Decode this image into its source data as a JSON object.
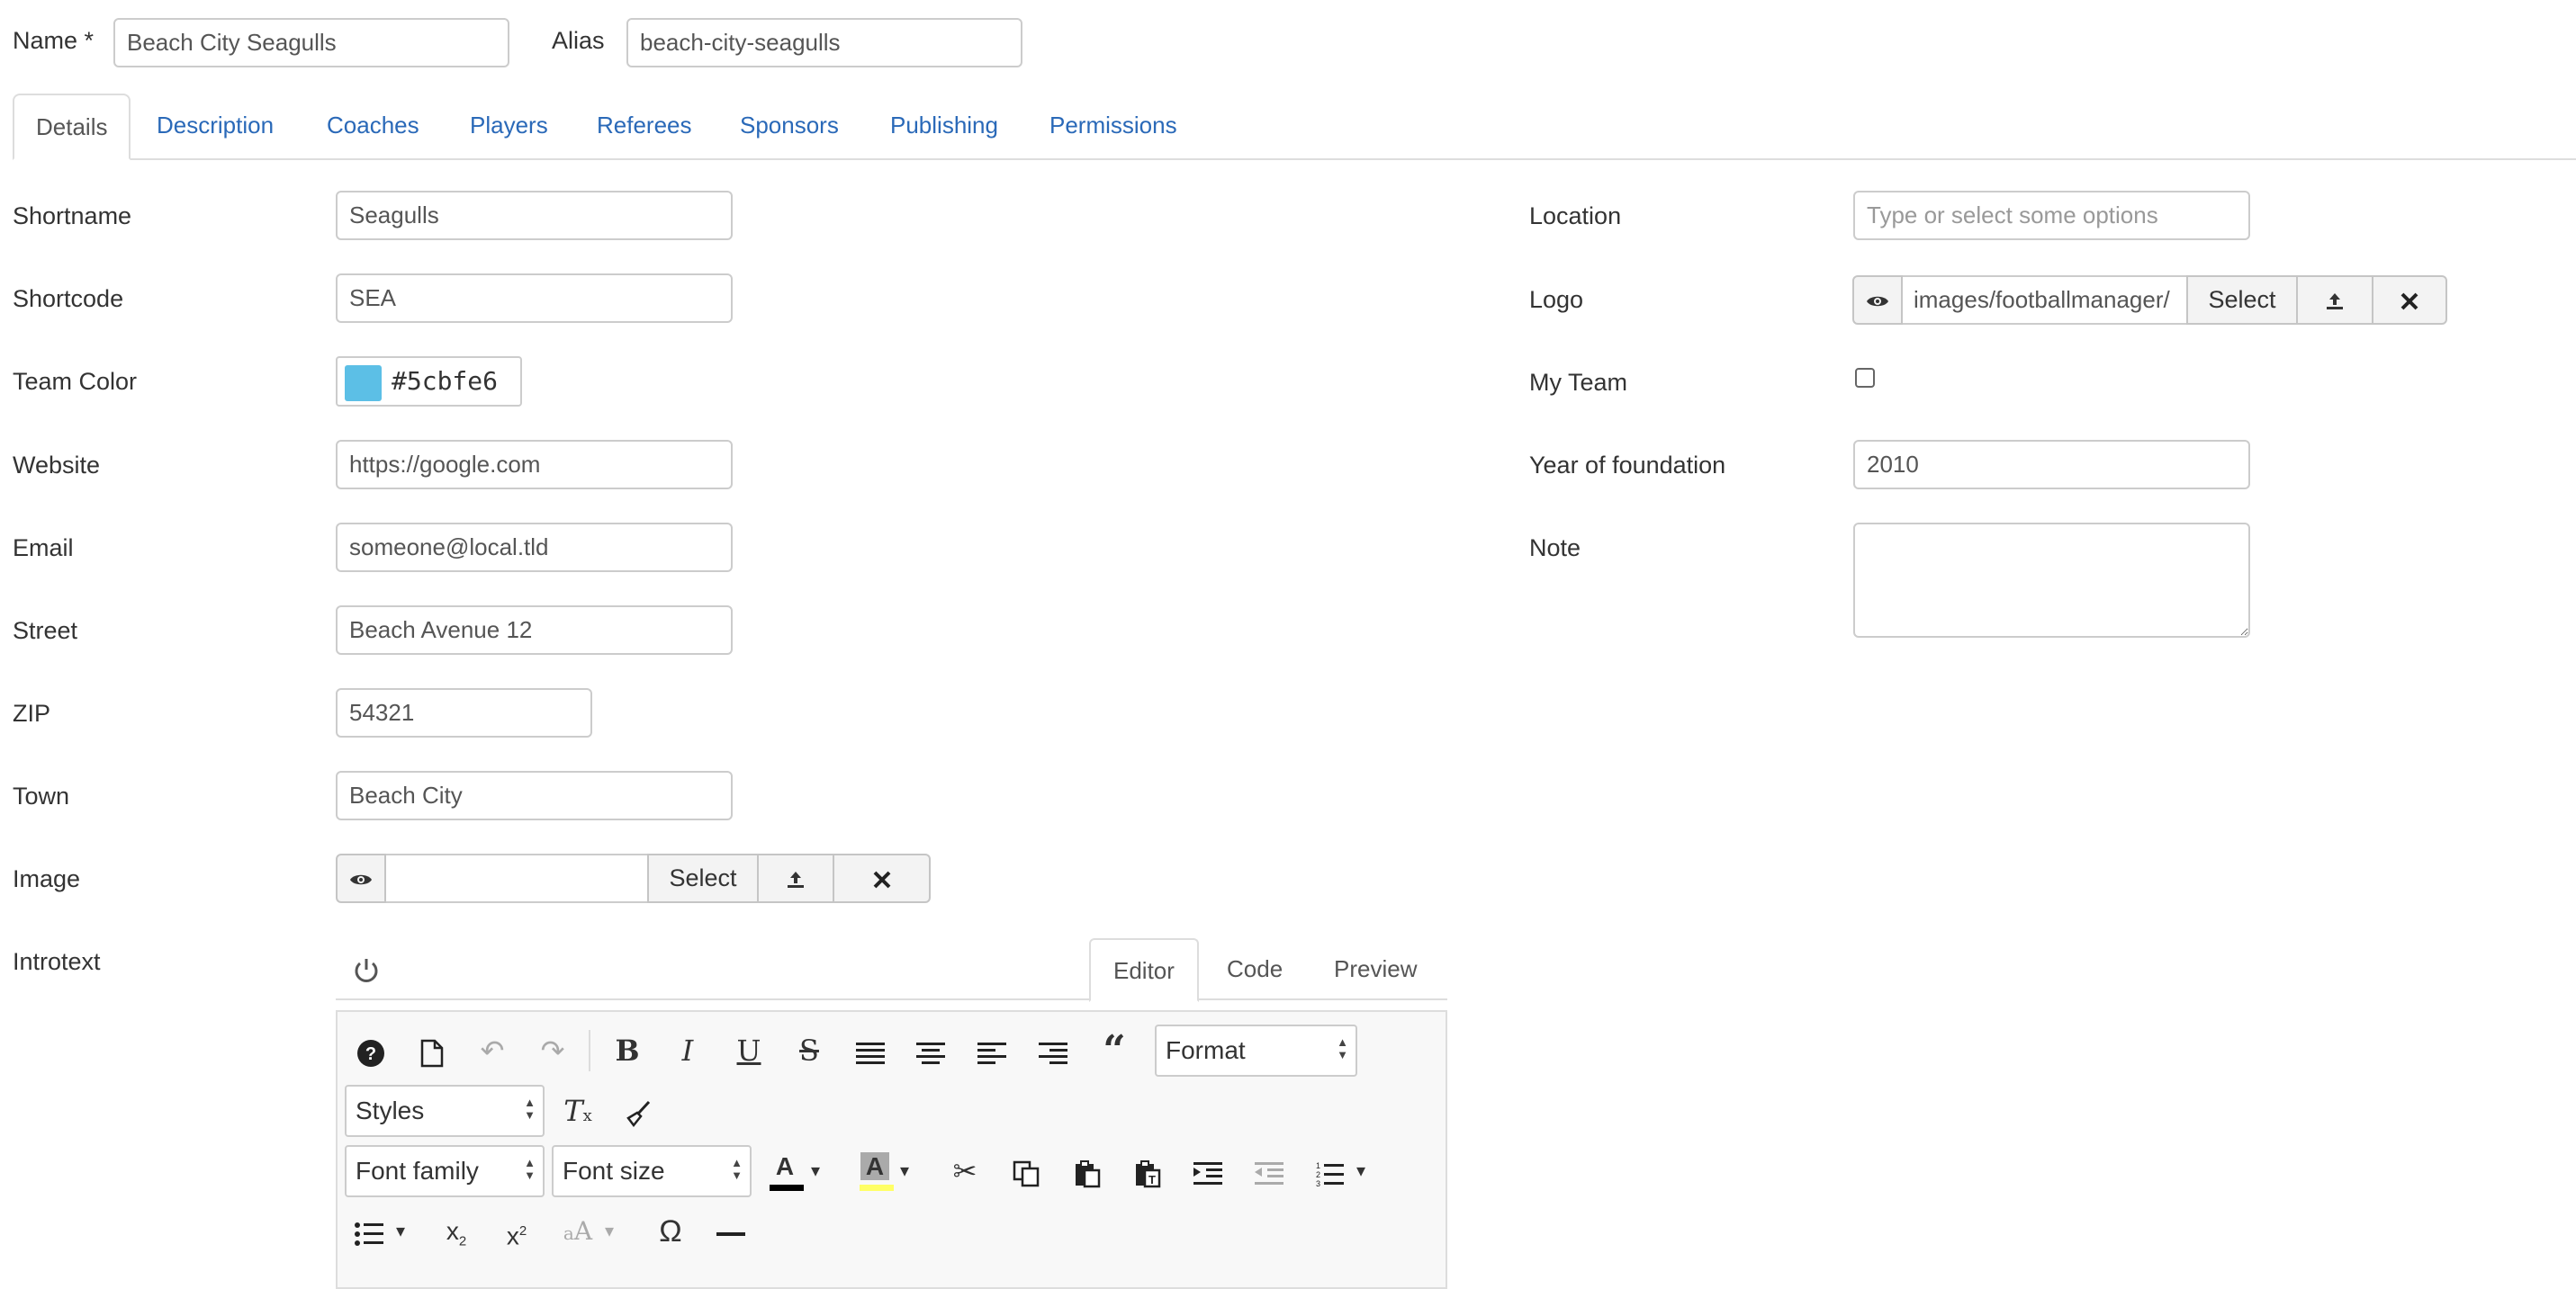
{
  "top": {
    "name_label": "Name *",
    "name_value": "Beach City Seagulls",
    "alias_label": "Alias",
    "alias_value": "beach-city-seagulls"
  },
  "tabs": [
    {
      "label": "Details",
      "active": true
    },
    {
      "label": "Description"
    },
    {
      "label": "Coaches"
    },
    {
      "label": "Players"
    },
    {
      "label": "Referees"
    },
    {
      "label": "Sponsors"
    },
    {
      "label": "Publishing"
    },
    {
      "label": "Permissions"
    }
  ],
  "left": {
    "shortname_label": "Shortname",
    "shortname_value": "Seagulls",
    "shortcode_label": "Shortcode",
    "shortcode_value": "SEA",
    "teamcolor_label": "Team Color",
    "teamcolor_value": "#5cbfe6",
    "website_label": "Website",
    "website_value": "https://google.com",
    "email_label": "Email",
    "email_value": "someone@local.tld",
    "street_label": "Street",
    "street_value": "Beach Avenue 12",
    "zip_label": "ZIP",
    "zip_value": "54321",
    "town_label": "Town",
    "town_value": "Beach City",
    "image_label": "Image",
    "image_value": "",
    "image_select": "Select",
    "introtext_label": "Introtext"
  },
  "right": {
    "location_label": "Location",
    "location_placeholder": "Type or select some options",
    "logo_label": "Logo",
    "logo_value": "images/footballmanager/",
    "logo_select": "Select",
    "myteam_label": "My Team",
    "myteam_checked": false,
    "year_label": "Year of foundation",
    "year_value": "2010",
    "note_label": "Note",
    "note_value": ""
  },
  "editor": {
    "tabs": [
      {
        "label": "Editor",
        "active": true
      },
      {
        "label": "Code"
      },
      {
        "label": "Preview"
      }
    ],
    "format_label": "Format",
    "styles_label": "Styles",
    "font_family_label": "Font family",
    "font_size_label": "Font size",
    "icons": [
      "help-icon",
      "new-document-icon",
      "undo-icon",
      "redo-icon",
      "bold-icon",
      "italic-icon",
      "underline-icon",
      "strikethrough-icon",
      "align-justify-icon",
      "align-center-icon",
      "align-left-icon",
      "align-right-icon",
      "blockquote-icon",
      "clear-formatting-icon",
      "clean-brush-icon",
      "text-color-icon",
      "background-color-icon",
      "cut-icon",
      "copy-icon",
      "paste-icon",
      "paste-text-icon",
      "indent-icon",
      "outdent-icon",
      "numbered-list-icon",
      "bullet-list-icon",
      "subscript-icon",
      "superscript-icon",
      "font-case-icon",
      "omega-icon",
      "horizontal-rule-icon"
    ]
  },
  "colors": {
    "link": "#2a69b8",
    "team_color": "#5cbfe6",
    "border": "#cccccc",
    "text_color_bar": "#000000",
    "bg_color_bar": "#ffff66"
  }
}
